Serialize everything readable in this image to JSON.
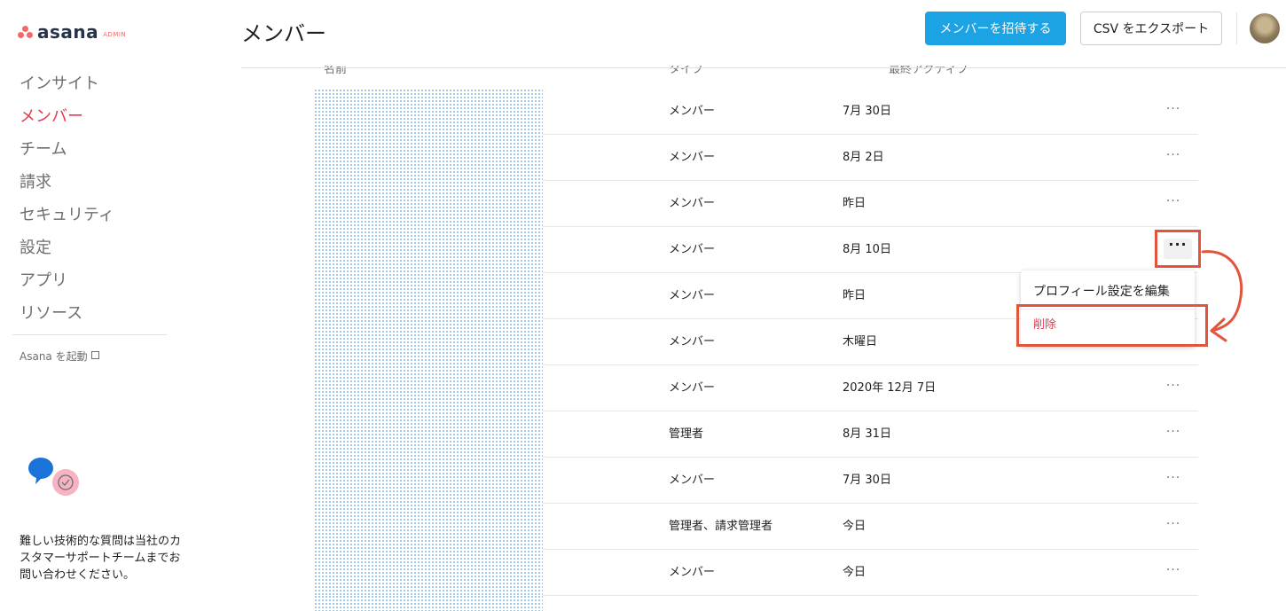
{
  "app": {
    "logo_text": "asana",
    "logo_badge": "ADMIN",
    "brand_color": "#f06a6a",
    "accent_color": "#1ba3e3",
    "danger_color": "#e8384f",
    "annotation_color": "#e2543b"
  },
  "sidebar": {
    "items": [
      {
        "label": "インサイト",
        "active": false
      },
      {
        "label": "メンバー",
        "active": true
      },
      {
        "label": "チーム",
        "active": false
      },
      {
        "label": "請求",
        "active": false
      },
      {
        "label": "セキュリティ",
        "active": false
      },
      {
        "label": "設定",
        "active": false
      },
      {
        "label": "アプリ",
        "active": false
      },
      {
        "label": "リソース",
        "active": false
      }
    ],
    "launch_label": "Asana を起動",
    "help_text": "難しい技術的な質問は当社のカスタマーサポートチームまでお問い合わせください。"
  },
  "header": {
    "title": "メンバー",
    "invite_button": "メンバーを招待する",
    "export_button": "CSV をエクスポート"
  },
  "table": {
    "columns": [
      "名前",
      "タイプ",
      "最終アクティブ"
    ],
    "rows": [
      {
        "type": "メンバー",
        "last_active": "7月 30日"
      },
      {
        "type": "メンバー",
        "last_active": "8月 2日"
      },
      {
        "type": "メンバー",
        "last_active": "昨日"
      },
      {
        "type": "メンバー",
        "last_active": "8月 10日"
      },
      {
        "type": "メンバー",
        "last_active": "昨日"
      },
      {
        "type": "メンバー",
        "last_active": "木曜日"
      },
      {
        "type": "メンバー",
        "last_active": "2020年 12月 7日"
      },
      {
        "type": "管理者",
        "last_active": "8月 31日"
      },
      {
        "type": "メンバー",
        "last_active": "7月 30日"
      },
      {
        "type": "管理者、請求管理者",
        "last_active": "今日"
      },
      {
        "type": "メンバー",
        "last_active": "今日"
      }
    ],
    "more_glyph": "···"
  },
  "context_menu": {
    "edit_label": "プロフィール設定を編集",
    "delete_label": "削除"
  }
}
